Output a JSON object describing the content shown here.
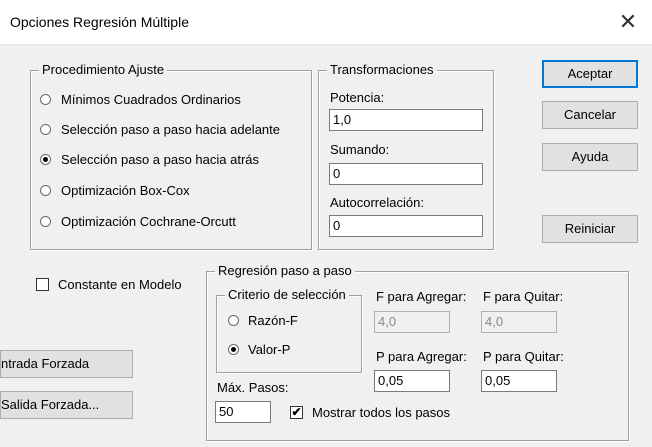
{
  "window": {
    "title": "Opciones Regresión Múltiple",
    "close_glyph": "✕"
  },
  "procedimiento": {
    "title": "Procedimiento Ajuste",
    "options": [
      {
        "label": "Mínimos Cuadrados Ordinarios",
        "selected": false
      },
      {
        "label": "Selección paso a paso hacia adelante",
        "selected": false
      },
      {
        "label": "Selección paso a paso hacia atrás",
        "selected": true
      },
      {
        "label": "Optimización Box-Cox",
        "selected": false
      },
      {
        "label": "Optimización Cochrane-Orcutt",
        "selected": false
      }
    ]
  },
  "transformaciones": {
    "title": "Transformaciones",
    "potencia": {
      "label": "Potencia:",
      "value": "1,0"
    },
    "sumando": {
      "label": "Sumando:",
      "value": "0"
    },
    "autocorrelacion": {
      "label": "Autocorrelación:",
      "value": "0"
    }
  },
  "buttons": {
    "aceptar": "Aceptar",
    "cancelar": "Cancelar",
    "ayuda": "Ayuda",
    "reiniciar": "Reiniciar",
    "entrada_forzada": "ntrada Forzada",
    "salida_forzada": "Salida Forzada..."
  },
  "constante": {
    "label": "Constante en Modelo",
    "checked": false
  },
  "regresion_paso": {
    "title": "Regresión paso a paso",
    "criterio": {
      "title": "Criterio de selección",
      "options": [
        {
          "label": "Razón-F",
          "selected": false
        },
        {
          "label": "Valor-P",
          "selected": true
        }
      ]
    },
    "f_agregar": {
      "label": "F para Agregar:",
      "value": "4,0"
    },
    "f_quitar": {
      "label": "F para Quitar:",
      "value": "4,0"
    },
    "p_agregar": {
      "label": "P para Agregar:",
      "value": "0,05"
    },
    "p_quitar": {
      "label": "P para Quitar:",
      "value": "0,05"
    },
    "max_pasos": {
      "label": "Máx. Pasos:",
      "value": "50"
    },
    "mostrar": {
      "label": "Mostrar todos los pasos",
      "checked": true,
      "check_glyph": "✔"
    }
  }
}
